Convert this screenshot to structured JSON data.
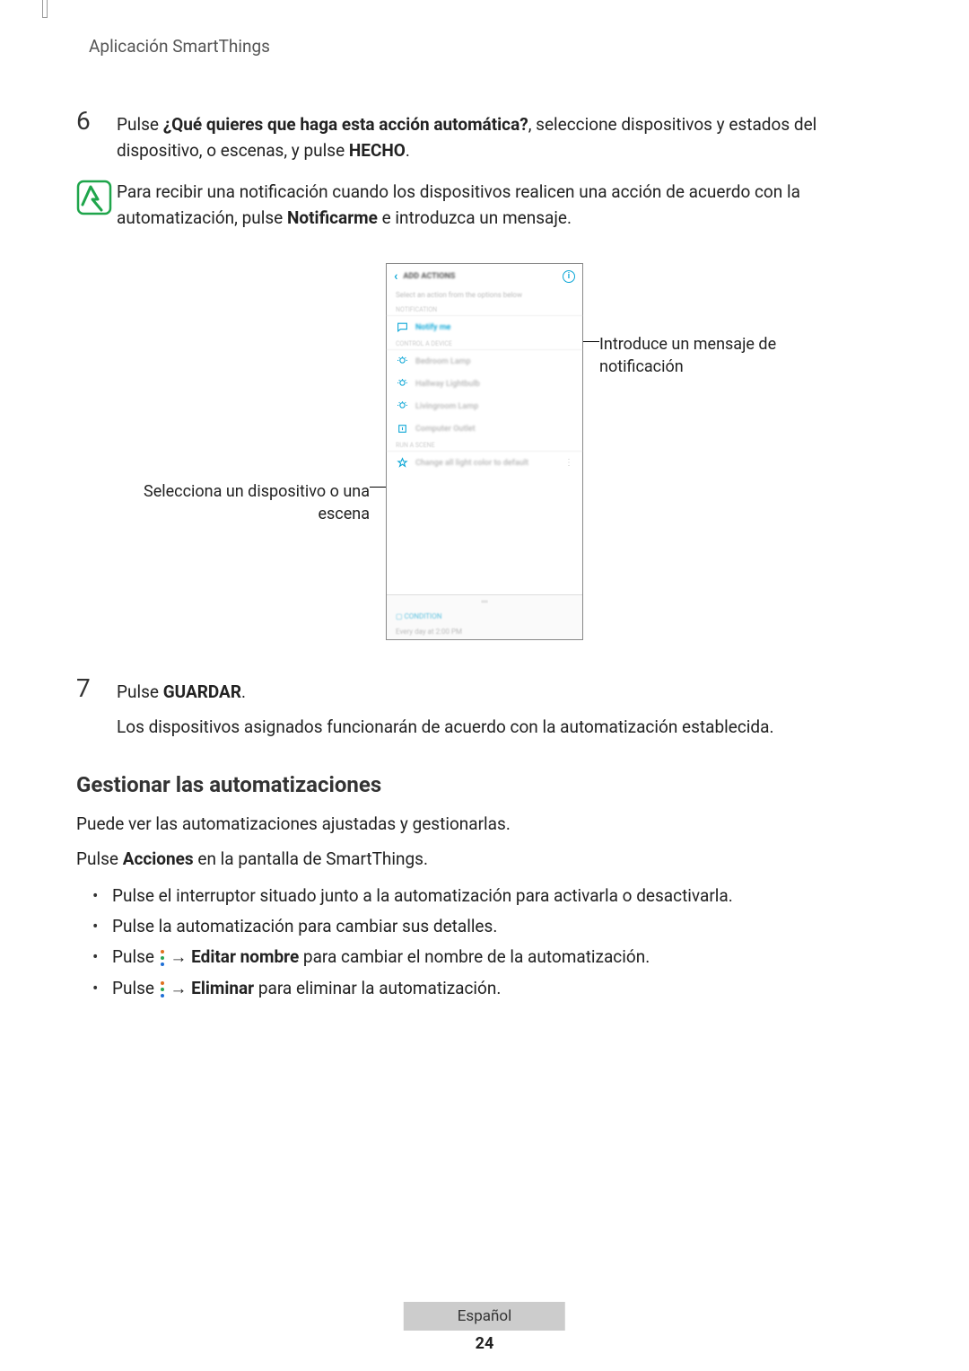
{
  "header": {
    "app_title": "Aplicación SmartThings"
  },
  "step6": {
    "number": "6",
    "pre": "Pulse ",
    "bold1": "¿Qué quieres que haga esta acción automática?",
    "mid": ", seleccione dispositivos y estados del dispositivo, o escenas, y pulse ",
    "bold2": "HECHO",
    "post": "."
  },
  "note": {
    "line1_pre": "Para recibir una notificación cuando los dispositivos realicen una acción de acuerdo con la automatización, pulse ",
    "bold": "Notificarme",
    "line1_post": " e introduzca un mensaje."
  },
  "figure": {
    "left_callout": "Selecciona un dispositivo o una escena",
    "right_callout": "Introduce un mensaje de notificación",
    "phone": {
      "screen_title": "ADD ACTIONS",
      "subtitle": "Select an action from the options below",
      "section_notification": "NOTIFICATION",
      "notify_me": "Notify me",
      "section_control": "CONTROL A DEVICE",
      "devices": [
        "Bedroom Lamp",
        "Hallway Lightbulb",
        "Livingroom Lamp",
        "Computer Outlet"
      ],
      "section_scene": "RUN A SCENE",
      "scene": "Change all light color to default",
      "footer_title": "CONDITION",
      "footer_detail": "Every day at 2:00 PM"
    }
  },
  "step7": {
    "number": "7",
    "pre": "Pulse ",
    "bold": "GUARDAR",
    "post": ".",
    "line2": "Los dispositivos asignados funcionarán de acuerdo con la automatización establecida."
  },
  "section2": {
    "heading": "Gestionar las automatizaciones",
    "p1": "Puede ver las automatizaciones ajustadas y gestionarlas.",
    "p2_pre": "Pulse ",
    "p2_bold": "Acciones",
    "p2_post": " en la pantalla de SmartThings.",
    "bullets": {
      "b1": "Pulse el interruptor situado junto a la automatización para activarla o desactivarla.",
      "b2": "Pulse la automatización para cambiar sus detalles.",
      "b3_pre": "Pulse ",
      "b3_arrow": " → ",
      "b3_bold": "Editar nombre",
      "b3_post": " para cambiar el nombre de la automatización.",
      "b4_pre": "Pulse ",
      "b4_arrow": " → ",
      "b4_bold": "Eliminar",
      "b4_post": " para eliminar la automatización."
    }
  },
  "footer": {
    "language": "Español",
    "page": "24"
  }
}
